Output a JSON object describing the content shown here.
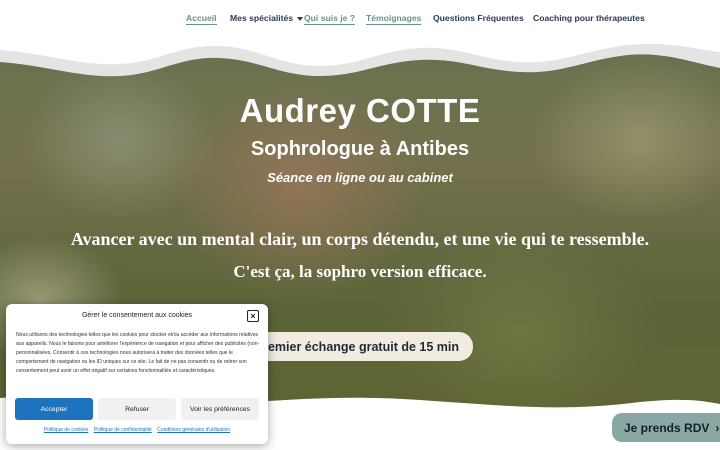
{
  "nav": {
    "items": [
      {
        "label": "Accueil"
      },
      {
        "label": "Mes spécialités"
      },
      {
        "label": "Qui suis je ?"
      },
      {
        "label": "Témoignages"
      },
      {
        "label": "Questions Fréquentes"
      },
      {
        "label": "Coaching pour thérapeutes"
      }
    ]
  },
  "hero": {
    "name": "Audrey COTTE",
    "role": "Sophrologue à Antibes",
    "mode": "Séance en ligne ou au cabinet",
    "tagline": "Avancer avec un mental clair, un corps détendu, et une vie qui te ressemble.",
    "subtagline": "C'est ça, la sophro version efficace.",
    "cta": "premier échange gratuit de 15 min"
  },
  "rdv": {
    "label": "Je prends RDV"
  },
  "cookie": {
    "title": "Gérer le consentement aux cookies",
    "text": "Nous utilisons des technologies telles que les cookies pour stocker et/ou accéder aux informations relatives aux appareils. Nous le faisons pour améliorer l'expérience de navigation et pour afficher des publicités (non-personnalisées. Consentir à ces technologies nous autorisera à traiter des données telles que le comportement de navigation ou les ID uniques sur ce site. Le fait de ne pas consentir ou de retirer son consentement peut avoir un effet négatif sur certaines fonctionnalités et caractéristiques.",
    "accept": "Accepter",
    "refuse": "Refuser",
    "prefs": "Voir les préférences",
    "links": [
      "Politique de cookies",
      "Politique de confidentialité",
      "Conditions générales d'utilisation"
    ]
  },
  "colors": {
    "accent": "#6f8f8a",
    "nav_text": "#2a3a4a",
    "accept": "#1e73be",
    "rdv": "#8aa8a3",
    "cta_bg": "#f2ece0"
  }
}
